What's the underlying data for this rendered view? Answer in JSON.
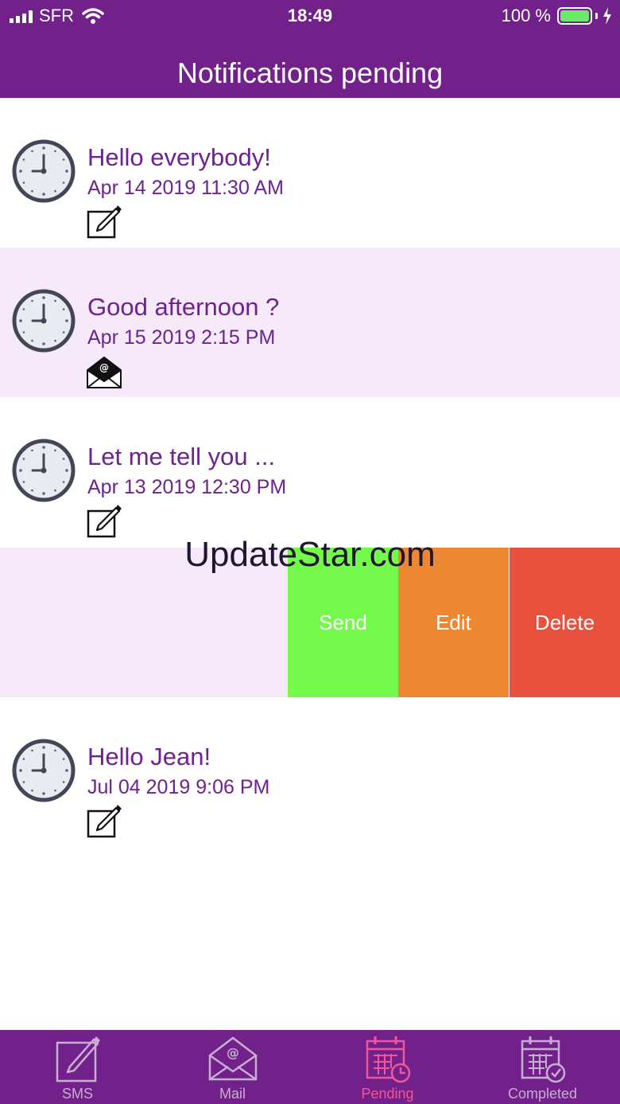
{
  "status_bar": {
    "carrier": "SFR",
    "time": "18:49",
    "battery": "100 %"
  },
  "header": {
    "title": "Notifications pending"
  },
  "notifications": [
    {
      "title": "Hello everybody!",
      "date": "Apr 14 2019 11:30 AM",
      "type_icon": "edit-icon"
    },
    {
      "title": "Good afternoon ?",
      "date": "Apr 15 2019 2:15 PM",
      "type_icon": "mail-icon"
    },
    {
      "title": "Let me tell you ...",
      "date": "Apr 13 2019 12:30 PM",
      "type_icon": "edit-icon"
    },
    {
      "title": "Hello Jean!",
      "date": "Jul 04 2019 9:06 PM",
      "type_icon": "edit-icon"
    }
  ],
  "swipe_actions": {
    "send": "Send",
    "edit": "Edit",
    "delete": "Delete"
  },
  "watermark": "UpdateStar.com",
  "tabs": [
    {
      "label": "SMS",
      "icon": "sms-icon"
    },
    {
      "label": "Mail",
      "icon": "mail-icon"
    },
    {
      "label": "Pending",
      "icon": "calendar-clock-icon",
      "active": true
    },
    {
      "label": "Completed",
      "icon": "calendar-check-icon"
    }
  ],
  "colors": {
    "header": "#72208a",
    "accent_text": "#6c2390",
    "row_alt": "#f6e9f9",
    "send": "#76f94d",
    "edit": "#ee8732",
    "delete": "#e9513f",
    "tab_active": "#f0579b"
  }
}
